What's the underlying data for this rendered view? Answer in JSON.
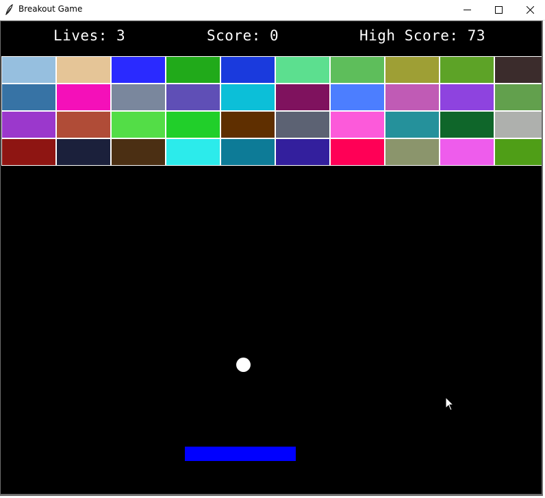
{
  "window": {
    "title": "Breakout Game",
    "icon": "feather-icon",
    "controls": [
      "minimize-icon",
      "maximize-icon",
      "close-icon"
    ]
  },
  "hud": {
    "lives_text": "Lives: 3",
    "score_text": "Score: 0",
    "high_score_text": "High Score: 73"
  },
  "game": {
    "background": "#000000",
    "ball_color": "#ffffff",
    "paddle_color": "#0000ff",
    "brick_border": "#ffffff",
    "brick_rows": [
      [
        "#96bfdf",
        "#e5c597",
        "#2a2aff",
        "#21aa1a",
        "#1a3add",
        "#5cdf8f",
        "#5ebe5b",
        "#9e9f35",
        "#5da327",
        "#3b2c2c"
      ],
      [
        "#3773a5",
        "#f410b9",
        "#7a879d",
        "#5f4fb6",
        "#0cbfd8",
        "#7f125e",
        "#4c7eff",
        "#c05bb5",
        "#8e43df",
        "#62a04d"
      ],
      [
        "#9b38cc",
        "#b04c37",
        "#53dd47",
        "#21cf2a",
        "#5f2f00",
        "#5c6273",
        "#fc5ada",
        "#25919b",
        "#0f662a",
        "#aeb0ad"
      ],
      [
        "#8e1512",
        "#1b203b",
        "#4b2f13",
        "#2cebeb",
        "#0d7b97",
        "#331f9d",
        "#ff0056",
        "#8b956c",
        "#ee5cec",
        "#4f9e17"
      ]
    ]
  },
  "cursor": {
    "icon": "mouse-pointer-icon"
  }
}
